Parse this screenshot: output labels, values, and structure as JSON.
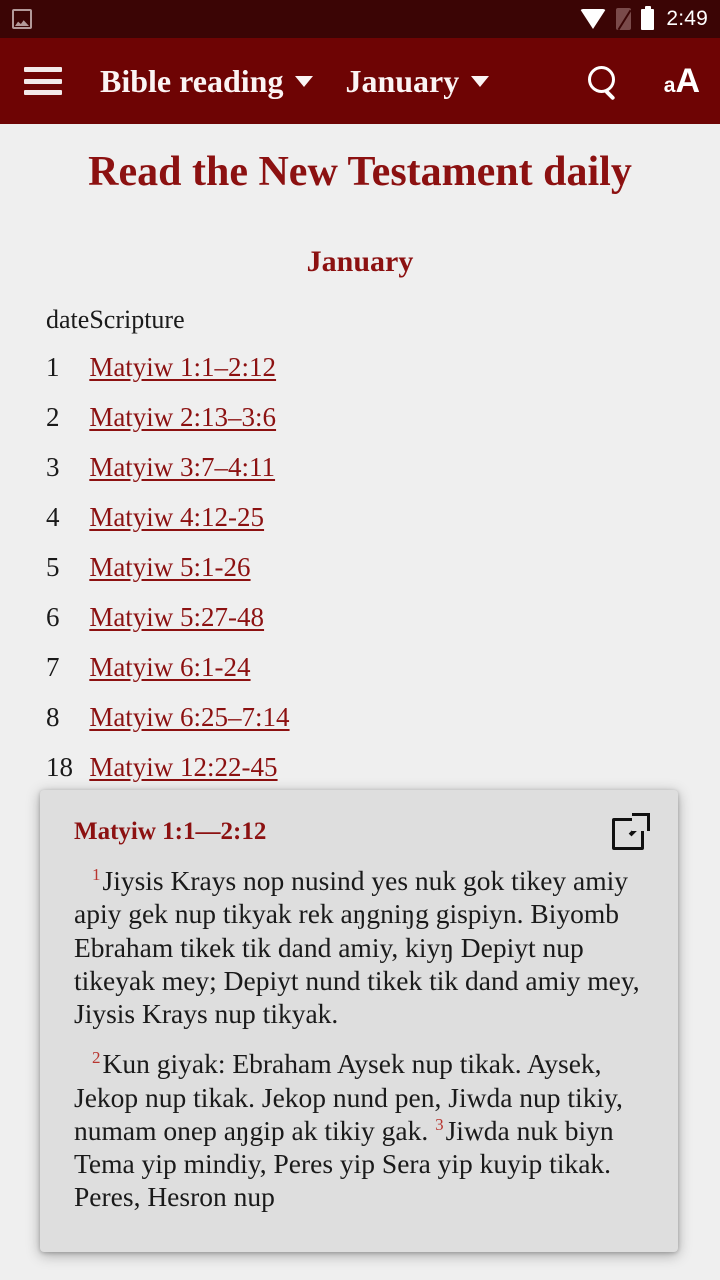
{
  "statusbar": {
    "time": "2:49",
    "icons": [
      "screenshot-image-icon",
      "wifi-icon",
      "no-sim-icon",
      "battery-icon"
    ]
  },
  "appbar": {
    "menu_icon": "hamburger-menu-icon",
    "title": "Bible reading",
    "month_selector": "January",
    "search_icon": "search-icon",
    "textsize_small": "a",
    "textsize_large": "A"
  },
  "document": {
    "title": "Read the New Testament daily",
    "month": "January",
    "columns": {
      "date": "date",
      "scripture": "Scripture"
    },
    "rows": [
      {
        "date": "1",
        "scripture": "Matyiw 1:1–2:12"
      },
      {
        "date": "2",
        "scripture": "Matyiw 2:13–3:6"
      },
      {
        "date": "3",
        "scripture": "Matyiw 3:7–4:11"
      },
      {
        "date": "4",
        "scripture": "Matyiw 4:12-25"
      },
      {
        "date": "5",
        "scripture": "Matyiw 5:1-26"
      },
      {
        "date": "6",
        "scripture": "Matyiw 5:27-48"
      },
      {
        "date": "7",
        "scripture": "Matyiw 6:1-24"
      },
      {
        "date": "8",
        "scripture": "Matyiw 6:25–7:14"
      },
      {
        "date": "18",
        "scripture": "Matyiw 12:22-45"
      }
    ]
  },
  "verse_card": {
    "title": "Matyiw 1:1—2:12",
    "open_icon": "open-in-new-icon",
    "verses": [
      {
        "number": "1",
        "text": "Jiysis Krays nop nusind yes nuk gok tikey amiy apiy gek nup tikyak rek aŋgniŋg gispiyn. Biyomb Ebraham tikek tik dand amiy, kiyŋ Depiyt nup tikeyak mey; Depiyt nund tikek tik dand amiy mey, Jiysis Krays nup tikyak."
      },
      {
        "number": "2",
        "text": "Kun giyak: Ebraham Aysek nup tikak. Aysek, Jekop nup tikak. Jekop nund pen, Jiwda nup tikiy, numam onep aŋgip ak tikiy gak. "
      },
      {
        "number": "3",
        "text": "Jiwda nuk biyn Tema yip mindiy, Peres yip Sera yip kuyip tikak. Peres, Hesron nup"
      }
    ]
  },
  "colors": {
    "statusbar_bg": "#3B0505",
    "appbar_bg": "#6E0404",
    "page_bg": "#EFEFEF",
    "accent_red": "#8C1111",
    "card_bg": "#DEDEDE",
    "verse_number": "#B8352F"
  }
}
